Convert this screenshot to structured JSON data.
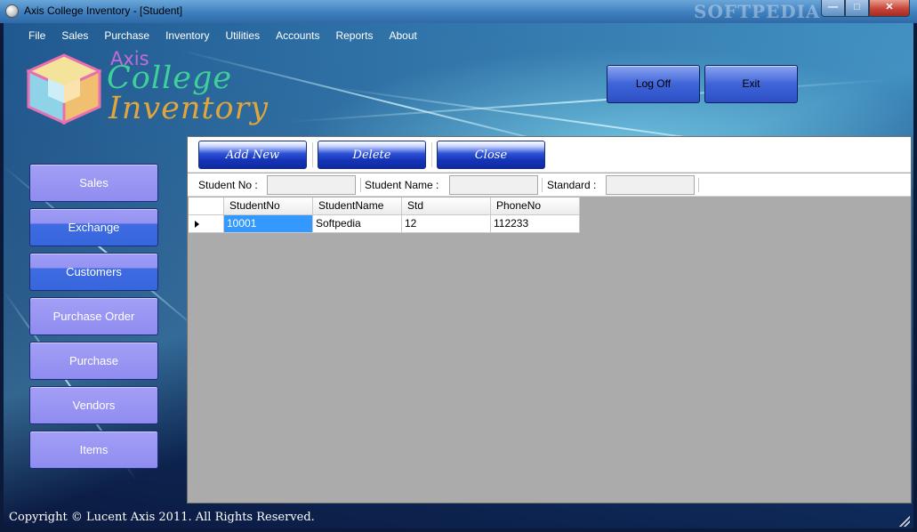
{
  "window": {
    "title": "Axis College Inventory - [Student]",
    "watermark": "SOFTPEDIA"
  },
  "menu": [
    "File",
    "Sales",
    "Purchase",
    "Inventory",
    "Utilities",
    "Accounts",
    "Reports",
    "About"
  ],
  "logo": {
    "line1": "Axis",
    "line2": "College",
    "line3": "Inventory"
  },
  "top_buttons": {
    "logoff": "Log Off",
    "exit": "Exit"
  },
  "sidebar": [
    "Sales",
    "Exchange",
    "Customers",
    "Purchase  Order",
    "Purchase",
    "Vendors",
    "Items"
  ],
  "toolbar": {
    "add_new": "Add New",
    "delete": "Delete",
    "close": "Close"
  },
  "filters": {
    "student_no_label": "Student No :",
    "student_name_label": "Student Name :",
    "standard_label": "Standard :",
    "student_no_value": "",
    "student_name_value": "",
    "standard_value": ""
  },
  "grid": {
    "columns": [
      "StudentNo",
      "StudentName",
      "Std",
      "PhoneNo"
    ],
    "rows": [
      [
        "10001",
        "Softpedia",
        "12",
        "112233"
      ]
    ]
  },
  "footer": "Copyright © Lucent Axis 2011. All Rights Reserved.",
  "colors": {
    "nav_light": "#9896f3",
    "nav_blue": "#3766dd",
    "selected_cell": "#3399ff"
  }
}
